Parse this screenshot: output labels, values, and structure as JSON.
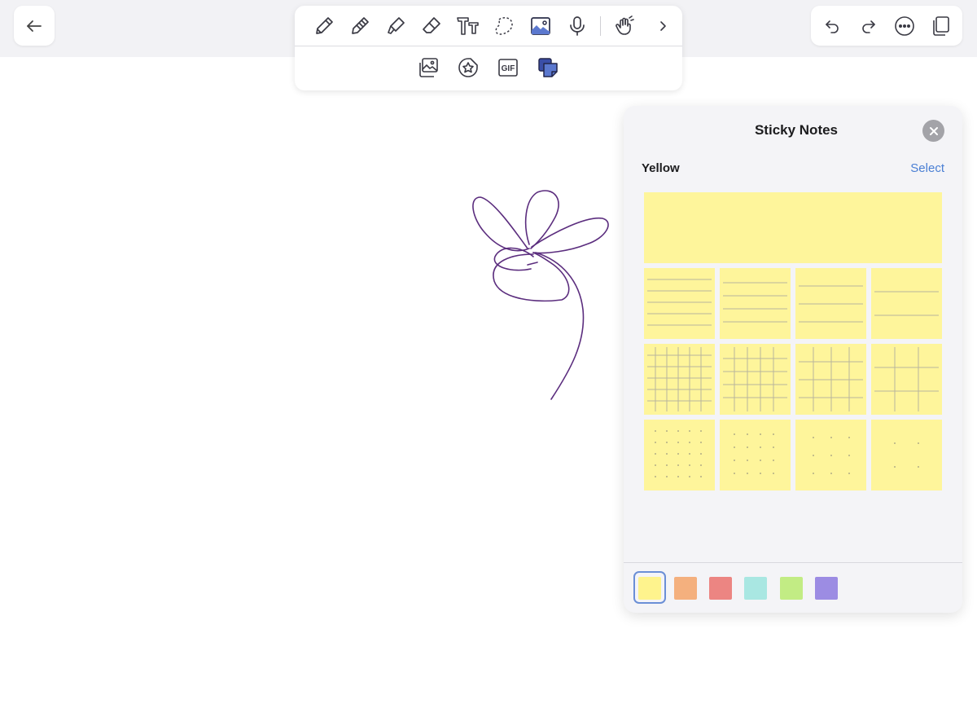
{
  "panel": {
    "title": "Sticky Notes",
    "section_label": "Yellow",
    "select_label": "Select"
  },
  "toolbar": {
    "row1": [
      "pen-icon",
      "pencil-icon",
      "highlighter-icon",
      "eraser-icon",
      "text-icon",
      "lasso-icon",
      "image-icon",
      "microphone-icon",
      "hand-draw-icon",
      "chevron-right-icon"
    ],
    "row2": [
      "photos-icon",
      "sticker-icon",
      "gif-icon",
      "sticky-notes-icon"
    ],
    "gif_text": "GIF"
  },
  "colors": {
    "accent": "#4a7fd4",
    "drawing_stroke": "#5b2d7e",
    "note_yellow": "#fef59b"
  },
  "swatches": [
    {
      "name": "yellow",
      "color": "#fef38d",
      "selected": true
    },
    {
      "name": "orange",
      "color": "#f4b07e",
      "selected": false
    },
    {
      "name": "red",
      "color": "#ec8582",
      "selected": false
    },
    {
      "name": "teal",
      "color": "#a9e7e2",
      "selected": false
    },
    {
      "name": "green",
      "color": "#c2ec84",
      "selected": false
    },
    {
      "name": "purple",
      "color": "#9c8ce3",
      "selected": false
    }
  ]
}
